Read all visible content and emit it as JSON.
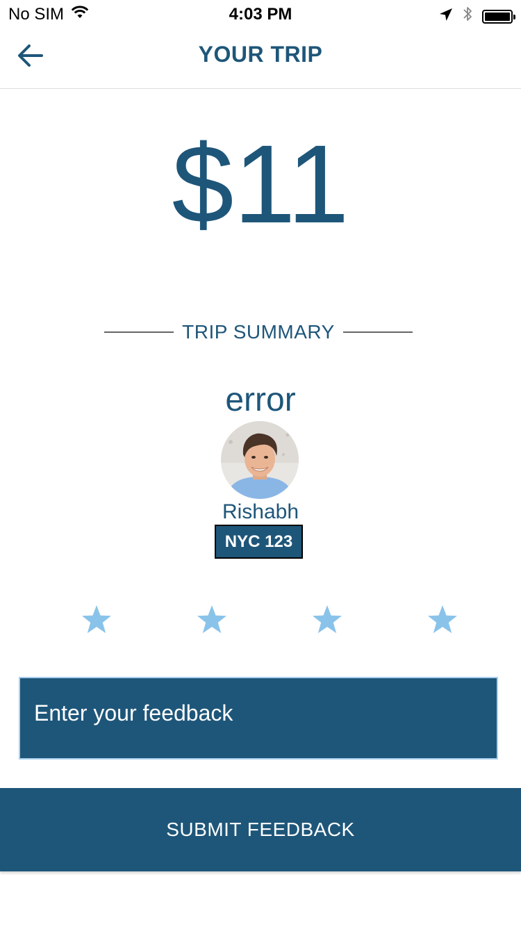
{
  "status_bar": {
    "carrier": "No SIM",
    "time": "4:03 PM",
    "icons": [
      "wifi-icon",
      "location-arrow-icon",
      "bluetooth-icon",
      "battery-icon"
    ]
  },
  "nav": {
    "title": "YOUR TRIP",
    "back_icon": "arrow-left-icon"
  },
  "trip": {
    "price": "$11",
    "summary_label": "TRIP SUMMARY",
    "status_text": "error"
  },
  "driver": {
    "name": "Rishabh",
    "plate": "NYC 123"
  },
  "rating": {
    "star_count": 4,
    "star_icon": "star-icon"
  },
  "feedback": {
    "placeholder": "Enter your feedback",
    "value": "",
    "submit_label": "SUBMIT FEEDBACK"
  },
  "colors": {
    "primary": "#1e5679",
    "star": "#8ac3ea",
    "input_border": "#a9d0ee",
    "divider": "#666666"
  }
}
